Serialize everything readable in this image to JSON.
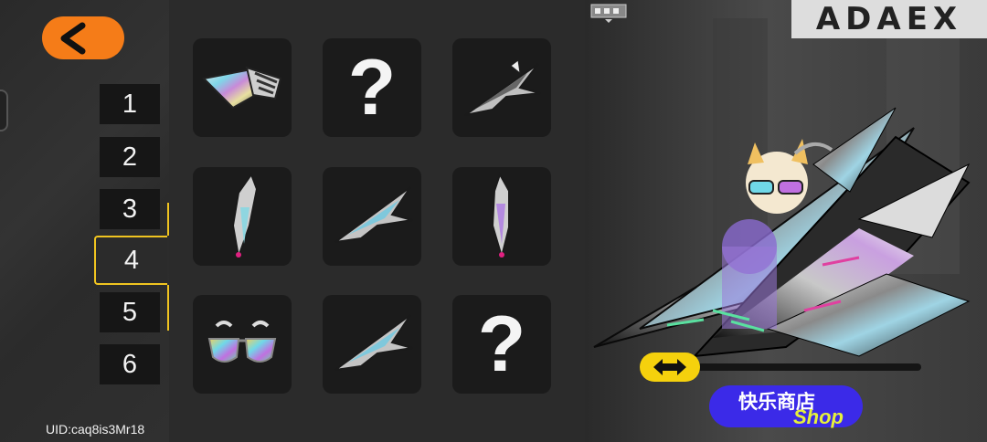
{
  "back_button": {
    "icon": "back-arrow-icon",
    "color": "#f57c18"
  },
  "tabs": [
    {
      "label": "1"
    },
    {
      "label": "2"
    },
    {
      "label": "3"
    },
    {
      "label": "4"
    },
    {
      "label": "5"
    },
    {
      "label": "6"
    }
  ],
  "active_tab": "4",
  "accent_color": "#f0c420",
  "uid": "UID:caq8is3Mr18",
  "grid": [
    {
      "item": "holographic-wings-icon",
      "locked": false
    },
    {
      "item": "unknown-item",
      "locked": true,
      "label": "?"
    },
    {
      "item": "holographic-jet-icon",
      "locked": false
    },
    {
      "item": "holographic-blade-icon",
      "locked": false
    },
    {
      "item": "holographic-jet-icon",
      "locked": false
    },
    {
      "item": "holographic-blade-icon",
      "locked": false
    },
    {
      "item": "holographic-sunglasses-icon",
      "locked": false
    },
    {
      "item": "holographic-jet-icon",
      "locked": false
    },
    {
      "item": "unknown-item",
      "locked": true,
      "label": "?"
    }
  ],
  "preview": {
    "logo": "ADAEX",
    "slider_handle_icon": "double-arrow-icon",
    "slider_value": 0.0
  },
  "shop": {
    "label_cn": "快乐商店",
    "label_en": "Shop"
  }
}
